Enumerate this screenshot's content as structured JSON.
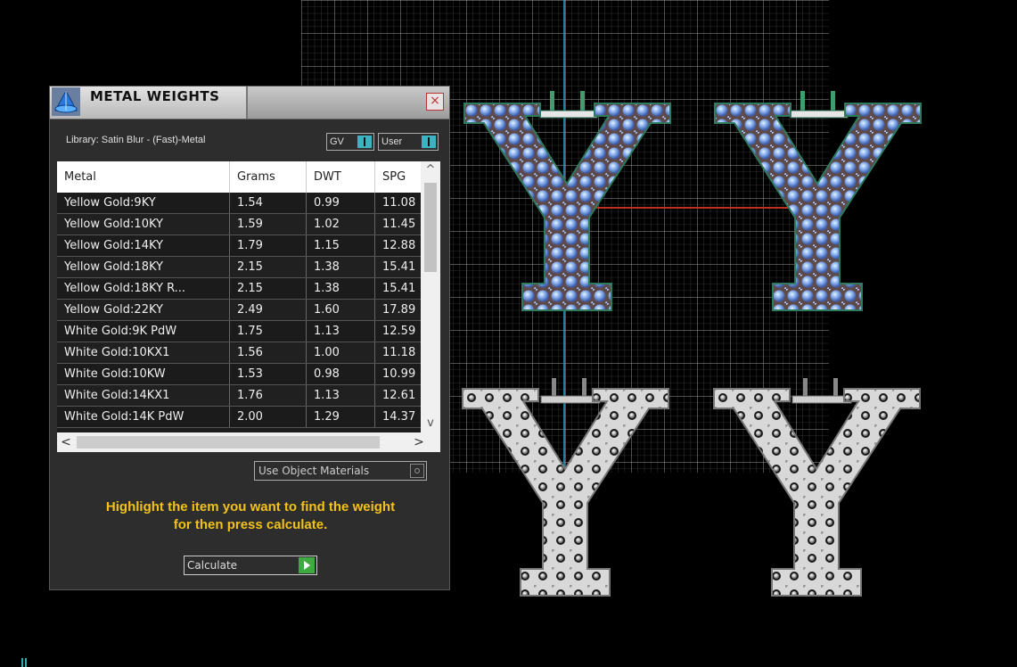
{
  "panel": {
    "title": "METAL WEIGHTS",
    "close_label": "×",
    "library": "Library: Satin Blur - (Fast)-Metal",
    "toggles": {
      "gv": "GV",
      "user": "User"
    },
    "columns": [
      "Metal",
      "Grams",
      "DWT",
      "SPG"
    ],
    "rows": [
      [
        "Yellow Gold:9KY",
        "1.54",
        "0.99",
        "11.08"
      ],
      [
        "Yellow Gold:10KY",
        "1.59",
        "1.02",
        "11.45"
      ],
      [
        "Yellow Gold:14KY",
        "1.79",
        "1.15",
        "12.88"
      ],
      [
        "Yellow Gold:18KY",
        "2.15",
        "1.38",
        "15.41"
      ],
      [
        "Yellow Gold:18KY R...",
        "2.15",
        "1.38",
        "15.41"
      ],
      [
        "Yellow Gold:22KY",
        "2.49",
        "1.60",
        "17.89"
      ],
      [
        "White Gold:9K PdW",
        "1.75",
        "1.13",
        "12.59"
      ],
      [
        "White Gold:10KX1",
        "1.56",
        "1.00",
        "11.18"
      ],
      [
        "White Gold:10KW",
        "1.53",
        "0.98",
        "10.99"
      ],
      [
        "White Gold:14KX1",
        "1.76",
        "1.13",
        "12.61"
      ],
      [
        "White Gold:14K PdW",
        "2.00",
        "1.29",
        "14.37"
      ]
    ],
    "use_object_materials": "Use Object Materials",
    "hint_line1": "Highlight the item you want to find the weight",
    "hint_line2": "for then press calculate.",
    "calculate": "Calculate"
  },
  "icons": {
    "app": "app-logo-icon",
    "close": "close-icon",
    "scroll_up": "chevron-up-icon",
    "scroll_down": "chevron-down-icon",
    "scroll_left": "chevron-left-icon",
    "scroll_right": "chevron-right-icon",
    "play": "play-icon"
  },
  "colors": {
    "hint": "#f2c21a",
    "toggle_accent": "#3bb3c3",
    "calc_accent": "#3faa3f",
    "grid": "#8a8a8a",
    "axis_blue": "#2aa8c8",
    "axis_red": "#c03020"
  }
}
